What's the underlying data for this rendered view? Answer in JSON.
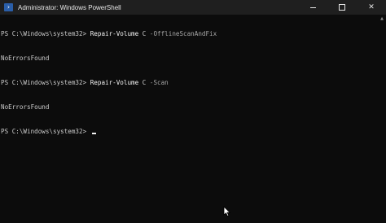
{
  "window": {
    "title": "Administrator: Windows PowerShell",
    "icon": "powershell-icon",
    "controls": {
      "minimize": "minimize-icon",
      "maximize": "maximize-icon",
      "close": "✕"
    }
  },
  "console": {
    "lines": [
      {
        "prompt": "PS C:\\Windows\\system32> ",
        "cmd": "Repair-Volume",
        "args": " C ",
        "param": "-OfflineScanAndFix"
      },
      {
        "output": "NoErrorsFound"
      },
      {
        "prompt": "PS C:\\Windows\\system32> ",
        "cmd": "Repair-Volume",
        "args": " C ",
        "param": "-Scan"
      },
      {
        "output": "NoErrorsFound"
      },
      {
        "prompt": "PS C:\\Windows\\system32> "
      }
    ]
  },
  "scroll_up_glyph": "▲",
  "cursor_icon": "mouse-pointer-icon"
}
